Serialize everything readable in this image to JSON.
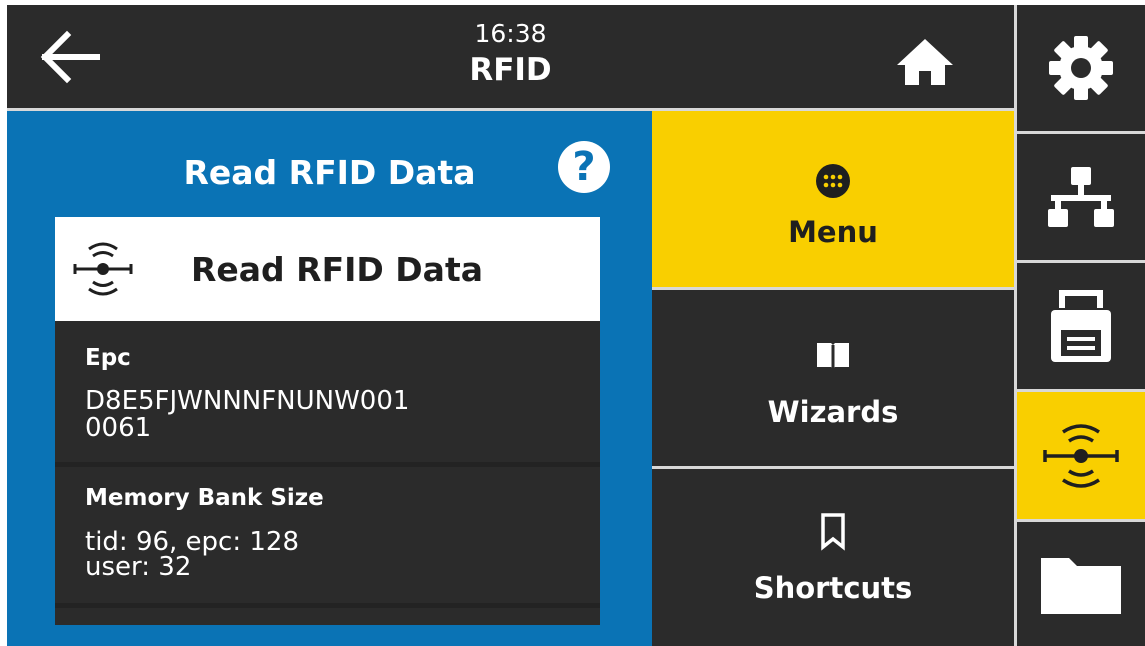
{
  "header": {
    "time": "16:38",
    "title": "RFID"
  },
  "panel": {
    "title": "Read RFID Data",
    "card_title": "Read RFID Data",
    "fields": [
      {
        "label": "Epc",
        "value_line1": "D8E5FJWNNNFNUNW001",
        "value_line2": "0061"
      },
      {
        "label": "Memory Bank Size",
        "value_line1": "tid: 96, epc: 128",
        "value_line2": "user: 32"
      }
    ]
  },
  "nav": {
    "menu": "Menu",
    "wizards": "Wizards",
    "shortcuts": "Shortcuts"
  },
  "sidebar": {
    "items": [
      "settings-icon",
      "network-icon",
      "printer-icon",
      "rfid-icon",
      "folder-icon"
    ],
    "active": "rfid-icon"
  },
  "colors": {
    "accent": "#f9cf00",
    "panel_blue": "#0a73b5",
    "dark": "#2b2b2b"
  }
}
